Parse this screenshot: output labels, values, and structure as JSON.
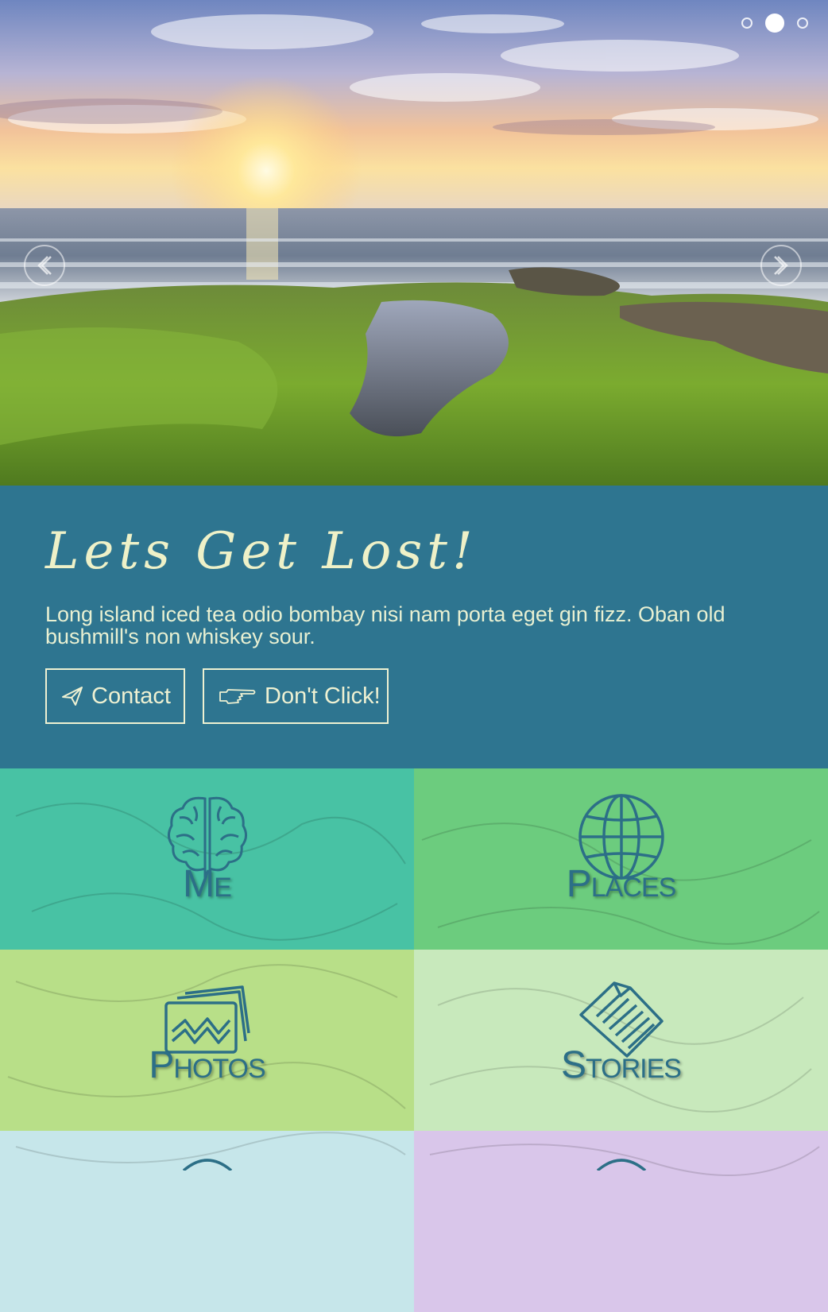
{
  "slider": {
    "dots": 3,
    "active_index": 1,
    "prev_icon": "chevron-left-icon",
    "next_icon": "chevron-right-icon"
  },
  "intro": {
    "title": "Lets Get Lost!",
    "body": "Long island iced tea odio bombay nisi nam porta eget gin fizz. Oban old bushmill's non whiskey sour.",
    "contact_label": "Contact",
    "contact_icon": "paper-plane-icon",
    "dont_click_label": "Don't Click!",
    "dont_click_icon": "pointing-hand-icon"
  },
  "tiles": [
    {
      "label": "Me",
      "icon": "brain-icon",
      "color": "#48c2a4"
    },
    {
      "label": "Places",
      "icon": "globe-icon",
      "color": "#6ccc7e"
    },
    {
      "label": "Photos",
      "icon": "photos-icon",
      "color": "#b8df88"
    },
    {
      "label": "Stories",
      "icon": "document-icon",
      "color": "#c8e9bc"
    },
    {
      "icon": "circle-icon",
      "color": "#c6e6ea"
    },
    {
      "icon": "circle-icon",
      "color": "#d9c6ea"
    }
  ],
  "colors": {
    "band": "#2e7590",
    "title_text": "#eef1c8",
    "tile_label": "#2c6f87"
  }
}
